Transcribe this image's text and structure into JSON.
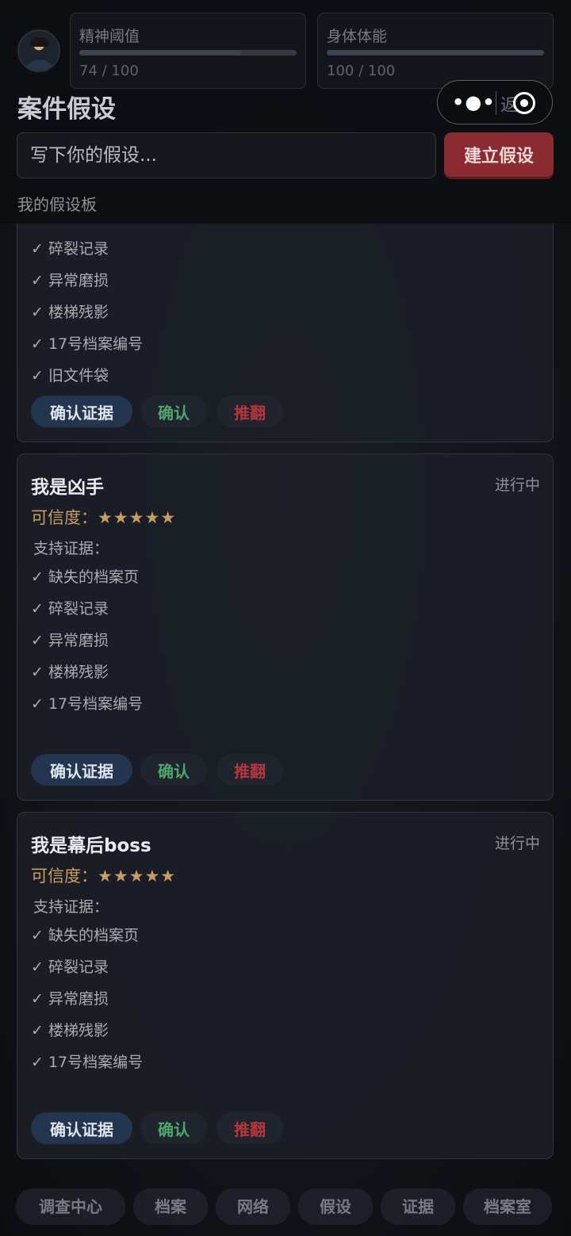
{
  "stats": {
    "mental": {
      "label": "精神阈值",
      "value": "74 / 100",
      "fraction": 0.74
    },
    "physical": {
      "label": "身体体能",
      "value": "100 / 100",
      "fraction": 1.0
    }
  },
  "page_title": "案件假设",
  "capsule": {
    "back_text": "返"
  },
  "input": {
    "placeholder": "写下你的假设..."
  },
  "create_button": "建立假设",
  "board_label": "我的假设板",
  "cards": [
    {
      "title": "",
      "status": "",
      "credibility_label": "",
      "stars": "",
      "support_label": "",
      "evidence": [
        "✓ 碎裂记录",
        "✓ 异常磨损",
        "✓ 楼梯残影",
        "✓ 17号档案编号",
        "✓ 旧文件袋"
      ],
      "actions": {
        "primary": "确认证据",
        "confirm": "确认",
        "reject": "推翻"
      }
    },
    {
      "title": "我是凶手",
      "status": "进行中",
      "credibility_label": "可信度：",
      "stars": "★★★★★",
      "support_label": "支持证据：",
      "evidence": [
        "✓ 缺失的档案页",
        "✓ 碎裂记录",
        "✓ 异常磨损",
        "✓ 楼梯残影",
        "✓ 17号档案编号"
      ],
      "actions": {
        "primary": "确认证据",
        "confirm": "确认",
        "reject": "推翻"
      }
    },
    {
      "title": "我是幕后boss",
      "status": "进行中",
      "credibility_label": "可信度：",
      "stars": "★★★★★",
      "support_label": "支持证据：",
      "evidence": [
        "✓ 缺失的档案页",
        "✓ 碎裂记录",
        "✓ 异常磨损",
        "✓ 楼梯残影",
        "✓ 17号档案编号"
      ],
      "actions": {
        "primary": "确认证据",
        "confirm": "确认",
        "reject": "推翻"
      }
    }
  ],
  "bottom_nav": [
    "调查中心",
    "档案",
    "网络",
    "假设",
    "证据",
    "档案室"
  ],
  "colors": {
    "accent_red": "#8a2a31",
    "confirm_green": "#4da76a",
    "reject_red": "#b8363b",
    "credibility_gold": "#c99d62"
  }
}
